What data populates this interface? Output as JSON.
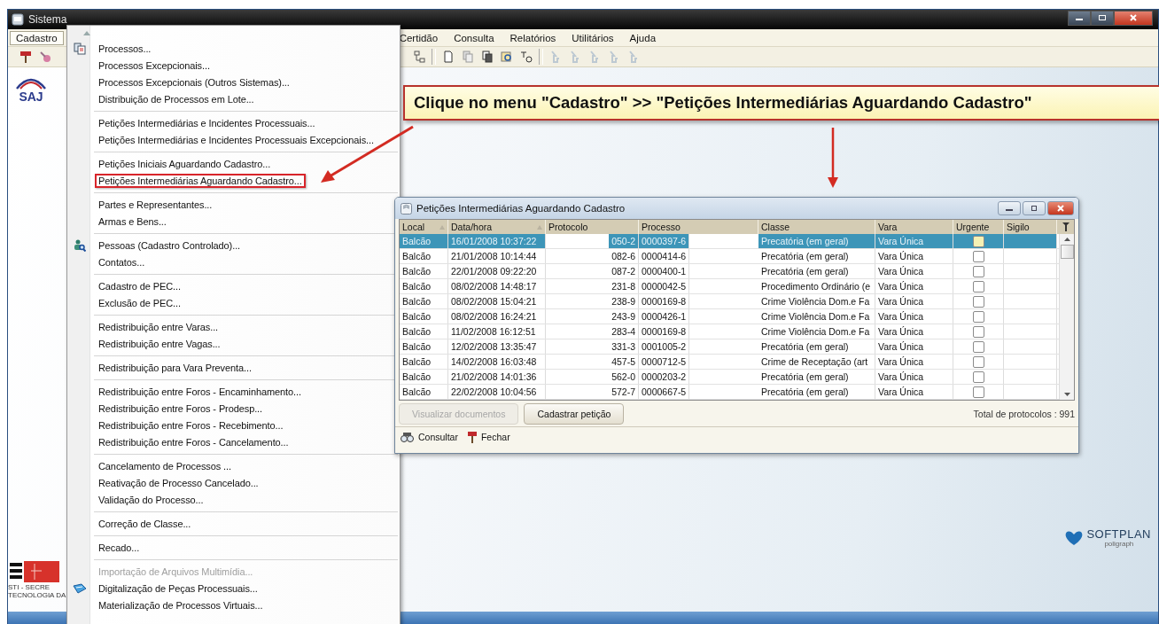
{
  "window": {
    "title": "Sistema"
  },
  "menubar": [
    {
      "label": "Cadastro",
      "selected": true
    },
    {
      "label": "Certidão",
      "selected": false
    },
    {
      "label": "Consulta",
      "selected": false
    },
    {
      "label": "Relatórios",
      "selected": false
    },
    {
      "label": "Utilitários",
      "selected": false
    },
    {
      "label": "Ajuda",
      "selected": false
    }
  ],
  "logo": {
    "text": "SAJ"
  },
  "menu": {
    "groups": [
      [
        {
          "label": "Processos...",
          "disabled": false,
          "highlighted": false
        },
        {
          "label": "Processos Excepcionais...",
          "disabled": false,
          "highlighted": false
        },
        {
          "label": "Processos Excepcionais (Outros Sistemas)...",
          "disabled": false,
          "highlighted": false
        },
        {
          "label": "Distribuição de Processos em Lote...",
          "disabled": false,
          "highlighted": false
        }
      ],
      [
        {
          "label": "Petições Intermediárias e Incidentes Processuais...",
          "disabled": false,
          "highlighted": false
        },
        {
          "label": "Petições Intermediárias e Incidentes Processuais Excepcionais...",
          "disabled": false,
          "highlighted": false
        }
      ],
      [
        {
          "label": "Petições Iniciais Aguardando Cadastro...",
          "disabled": false,
          "highlighted": false
        },
        {
          "label": "Petições Intermediárias Aguardando Cadastro...",
          "disabled": false,
          "highlighted": true
        }
      ],
      [
        {
          "label": "Partes e Representantes...",
          "disabled": false,
          "highlighted": false
        },
        {
          "label": "Armas e Bens...",
          "disabled": false,
          "highlighted": false
        }
      ],
      [
        {
          "label": "Pessoas (Cadastro Controlado)...",
          "disabled": false,
          "highlighted": false
        },
        {
          "label": "Contatos...",
          "disabled": false,
          "highlighted": false
        }
      ],
      [
        {
          "label": "Cadastro de PEC...",
          "disabled": false,
          "highlighted": false
        },
        {
          "label": "Exclusão de PEC...",
          "disabled": false,
          "highlighted": false
        }
      ],
      [
        {
          "label": "Redistribuição entre Varas...",
          "disabled": false,
          "highlighted": false
        },
        {
          "label": "Redistribuição entre Vagas...",
          "disabled": false,
          "highlighted": false
        }
      ],
      [
        {
          "label": "Redistribuição para Vara Preventa...",
          "disabled": false,
          "highlighted": false
        }
      ],
      [
        {
          "label": "Redistribuição entre Foros - Encaminhamento...",
          "disabled": false,
          "highlighted": false
        },
        {
          "label": "Redistribuição entre Foros - Prodesp...",
          "disabled": false,
          "highlighted": false
        },
        {
          "label": "Redistribuição entre Foros - Recebimento...",
          "disabled": false,
          "highlighted": false
        },
        {
          "label": "Redistribuição entre Foros - Cancelamento...",
          "disabled": false,
          "highlighted": false
        }
      ],
      [
        {
          "label": "Cancelamento de Processos ...",
          "disabled": false,
          "highlighted": false
        },
        {
          "label": "Reativação de Processo Cancelado...",
          "disabled": false,
          "highlighted": false
        },
        {
          "label": "Validação do Processo...",
          "disabled": false,
          "highlighted": false
        }
      ],
      [
        {
          "label": "Correção de Classe...",
          "disabled": false,
          "highlighted": false
        }
      ],
      [
        {
          "label": "Recado...",
          "disabled": false,
          "highlighted": false
        }
      ],
      [
        {
          "label": "Importação de Arquivos Multimídia...",
          "disabled": true,
          "highlighted": false
        },
        {
          "label": "Digitalização de Peças Processuais...",
          "disabled": false,
          "highlighted": false
        },
        {
          "label": "Materialização de Processos Virtuais...",
          "disabled": false,
          "highlighted": false
        }
      ]
    ]
  },
  "callout": {
    "text": "Clique no menu \"Cadastro\" >> \"Petições Intermediárias Aguardando Cadastro\""
  },
  "dialog": {
    "title": "Petições Intermediárias Aguardando Cadastro",
    "columns": [
      {
        "label": "Local",
        "sorted": true
      },
      {
        "label": "Data/hora",
        "sorted": true
      },
      {
        "label": "Protocolo",
        "sorted": false
      },
      {
        "label": "Processo",
        "sorted": false
      },
      {
        "label": "Classe",
        "sorted": false
      },
      {
        "label": "Vara",
        "sorted": false
      },
      {
        "label": "Urgente",
        "sorted": false
      },
      {
        "label": "Sigilo",
        "sorted": false
      }
    ],
    "rows": [
      {
        "local": "Balcão",
        "datetime": "16/01/2008 10:37:22",
        "protocol": "050-2",
        "process": "0000397-6",
        "class": "Precatória (em geral)",
        "court": "Vara Única",
        "urgent": false,
        "selected": true
      },
      {
        "local": "Balcão",
        "datetime": "21/01/2008 10:14:44",
        "protocol": "082-6",
        "process": "0000414-6",
        "class": "Precatória (em geral)",
        "court": "Vara Única",
        "urgent": false,
        "selected": false
      },
      {
        "local": "Balcão",
        "datetime": "22/01/2008 09:22:20",
        "protocol": "087-2",
        "process": "0000400-1",
        "class": "Precatória (em geral)",
        "court": "Vara Única",
        "urgent": false,
        "selected": false
      },
      {
        "local": "Balcão",
        "datetime": "08/02/2008 14:48:17",
        "protocol": "231-8",
        "process": "0000042-5",
        "class": "Procedimento Ordinário (e",
        "court": "Vara Única",
        "urgent": false,
        "selected": false
      },
      {
        "local": "Balcão",
        "datetime": "08/02/2008 15:04:21",
        "protocol": "238-9",
        "process": "0000169-8",
        "class": "Crime Violência Dom.e Fa",
        "court": "Vara Única",
        "urgent": false,
        "selected": false
      },
      {
        "local": "Balcão",
        "datetime": "08/02/2008 16:24:21",
        "protocol": "243-9",
        "process": "0000426-1",
        "class": "Crime Violência Dom.e Fa",
        "court": "Vara Única",
        "urgent": false,
        "selected": false
      },
      {
        "local": "Balcão",
        "datetime": "11/02/2008 16:12:51",
        "protocol": "283-4",
        "process": "0000169-8",
        "class": "Crime Violência Dom.e Fa",
        "court": "Vara Única",
        "urgent": false,
        "selected": false
      },
      {
        "local": "Balcão",
        "datetime": "12/02/2008 13:35:47",
        "protocol": "331-3",
        "process": "0001005-2",
        "class": "Precatória (em geral)",
        "court": "Vara Única",
        "urgent": false,
        "selected": false
      },
      {
        "local": "Balcão",
        "datetime": "14/02/2008 16:03:48",
        "protocol": "457-5",
        "process": "0000712-5",
        "class": "Crime de Receptação (art",
        "court": "Vara Única",
        "urgent": false,
        "selected": false
      },
      {
        "local": "Balcão",
        "datetime": "21/02/2008 14:01:36",
        "protocol": "562-0",
        "process": "0000203-2",
        "class": "Precatória (em geral)",
        "court": "Vara Única",
        "urgent": false,
        "selected": false
      },
      {
        "local": "Balcão",
        "datetime": "22/02/2008 10:04:56",
        "protocol": "572-7",
        "process": "0000667-5",
        "class": "Precatória (em geral)",
        "court": "Vara Única",
        "urgent": false,
        "selected": false
      }
    ],
    "buttons": [
      {
        "label": "Visualizar documentos",
        "disabled": true
      },
      {
        "label": "Cadastrar petição",
        "disabled": false
      }
    ],
    "total": "Total de protocolos : 991",
    "footer": [
      {
        "label": "Consultar"
      },
      {
        "label": "Fechar"
      }
    ]
  },
  "sti_logo": {
    "lines": [
      "STI - SECRE",
      "TECNOLOGIA DA"
    ]
  },
  "softplan_logo": {
    "name": "SOFTPLAN",
    "sub": "poligraph"
  }
}
